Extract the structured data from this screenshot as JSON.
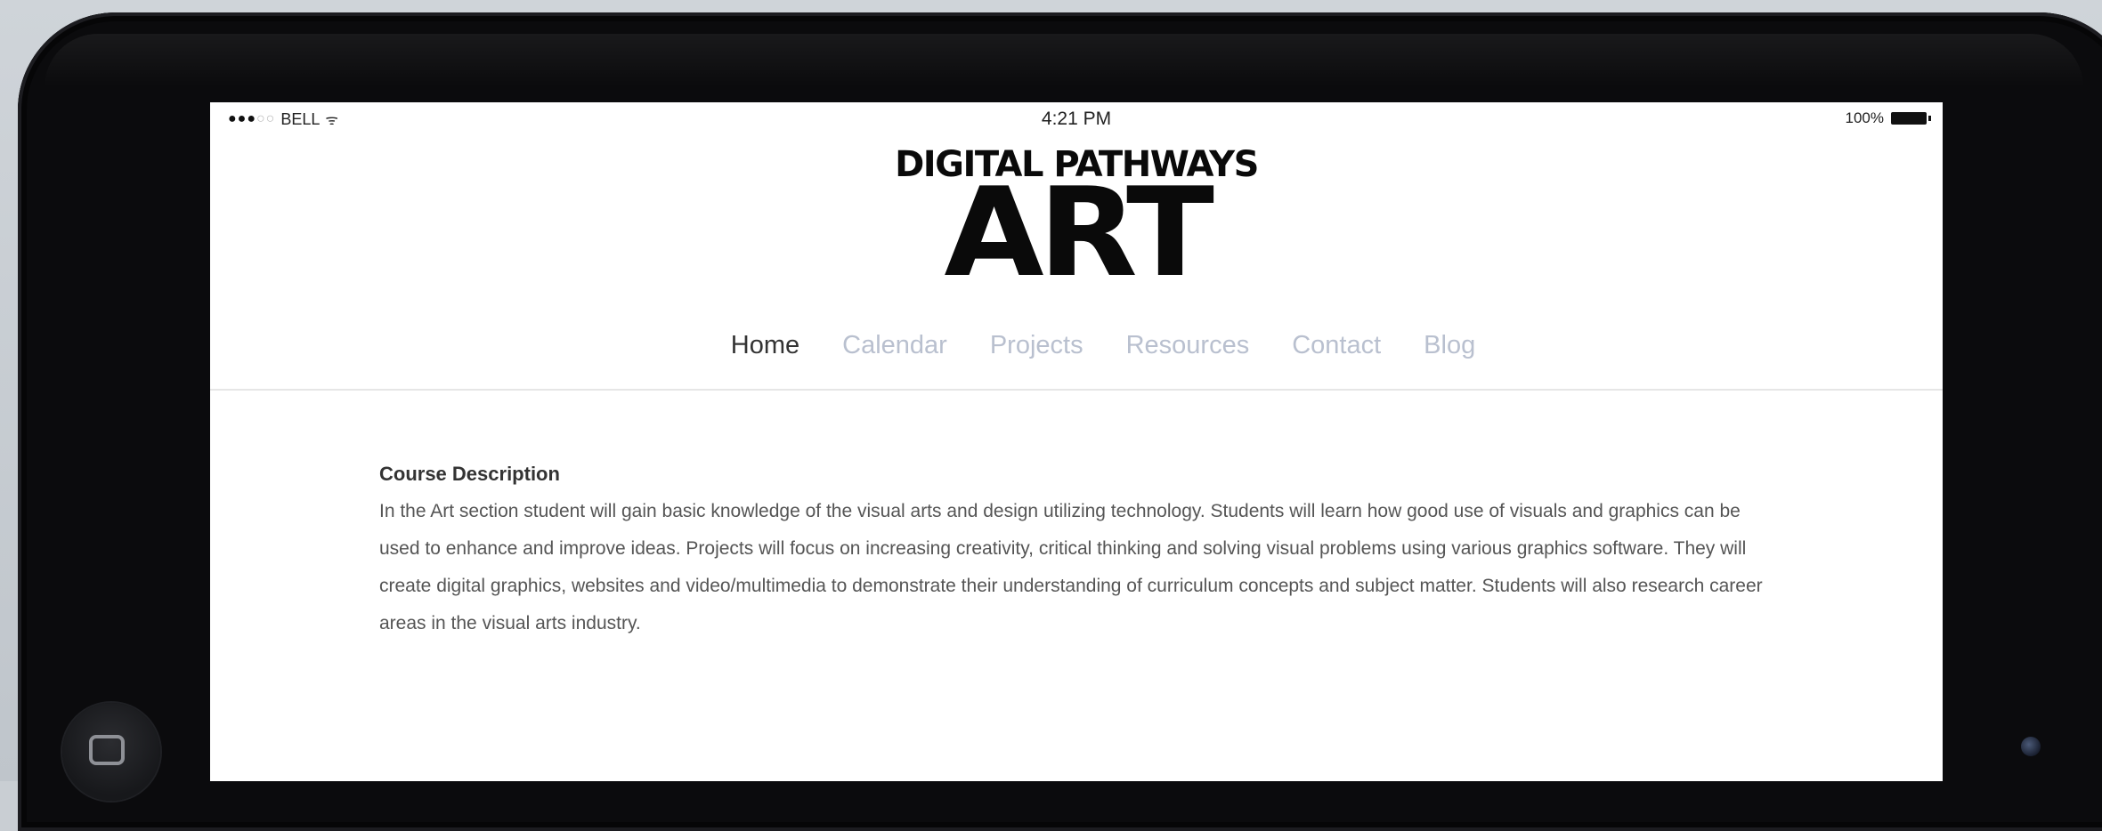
{
  "status_bar": {
    "carrier": "BELL",
    "signal_dots_on": 3,
    "signal_dots_total": 5,
    "time": "4:21 PM",
    "battery_text": "100%",
    "battery_level": 1.0
  },
  "logo": {
    "top_line": "DIGITAL PATHWAYS",
    "main_line": "ART"
  },
  "nav": {
    "items": [
      {
        "label": "Home",
        "active": true
      },
      {
        "label": "Calendar",
        "active": false
      },
      {
        "label": "Projects",
        "active": false
      },
      {
        "label": "Resources",
        "active": false
      },
      {
        "label": "Contact",
        "active": false
      },
      {
        "label": "Blog",
        "active": false
      }
    ]
  },
  "content": {
    "heading": "Course Description",
    "body": "In the Art section student will gain basic knowledge of the visual arts and design utilizing technology. Students will learn how good use of visuals and graphics can be used to enhance and improve ideas. Projects will focus on increasing creativity, critical thinking and solving visual problems using various graphics software. They will create digital graphics, websites and video/multimedia to demonstrate their understanding of curriculum concepts and subject matter. Students will also research career areas in the visual arts industry."
  },
  "colors": {
    "nav_active": "#333333",
    "nav_inactive": "#b9c0cf",
    "device_frame": "#0b0b0d",
    "screen_bg": "#ffffff"
  },
  "icons": {
    "wifi": "wifi-icon",
    "battery": "battery-icon",
    "home_button": "home-button-icon",
    "camera": "camera-icon"
  }
}
